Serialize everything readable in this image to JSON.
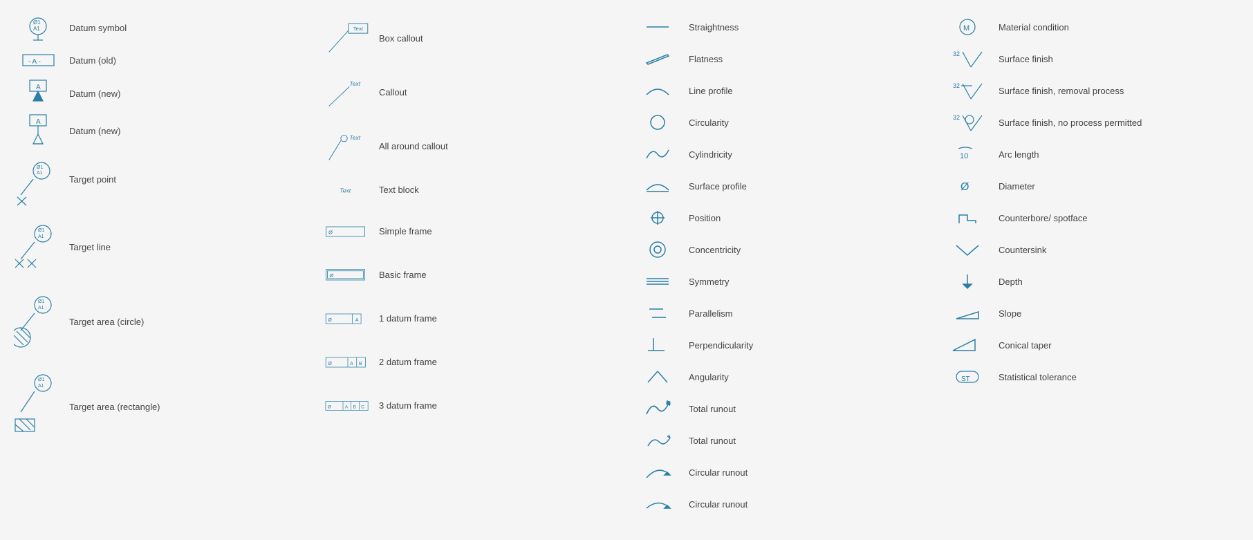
{
  "col1": {
    "items": [
      {
        "id": "datum-symbol",
        "label": "Datum symbol"
      },
      {
        "id": "datum-old",
        "label": "Datum (old)"
      },
      {
        "id": "datum-new-1",
        "label": "Datum (new)"
      },
      {
        "id": "datum-new-2",
        "label": "Datum (new)"
      },
      {
        "id": "target-point",
        "label": "Target point"
      },
      {
        "id": "target-line",
        "label": "Target line"
      },
      {
        "id": "target-area-circle",
        "label": "Target area (circle)"
      },
      {
        "id": "target-area-rect",
        "label": "Target area (rectangle)"
      }
    ]
  },
  "col2": {
    "items": [
      {
        "id": "box-callout",
        "label": "Box callout"
      },
      {
        "id": "callout",
        "label": "Callout"
      },
      {
        "id": "all-around-callout",
        "label": "All around callout"
      },
      {
        "id": "text-block",
        "label": "Text block"
      },
      {
        "id": "simple-frame",
        "label": "Simple frame"
      },
      {
        "id": "basic-frame",
        "label": "Basic frame"
      },
      {
        "id": "1-datum-frame",
        "label": "1 datum frame"
      },
      {
        "id": "2-datum-frame",
        "label": "2 datum frame"
      },
      {
        "id": "3-datum-frame",
        "label": "3 datum frame"
      }
    ]
  },
  "col3": {
    "items": [
      {
        "id": "straightness",
        "label": "Straightness"
      },
      {
        "id": "flatness",
        "label": "Flatness"
      },
      {
        "id": "line-profile",
        "label": "Line profile"
      },
      {
        "id": "circularity",
        "label": "Circularity"
      },
      {
        "id": "cylindricity",
        "label": "Cylindricity"
      },
      {
        "id": "surface-profile",
        "label": "Surface profile"
      },
      {
        "id": "position",
        "label": "Position"
      },
      {
        "id": "concentricity",
        "label": "Concentricity"
      },
      {
        "id": "symmetry",
        "label": "Symmetry"
      },
      {
        "id": "parallelism",
        "label": "Parallelism"
      },
      {
        "id": "perpendicularity",
        "label": "Perpendicularity"
      },
      {
        "id": "angularity",
        "label": "Angularity"
      },
      {
        "id": "total-runout-1",
        "label": "Total runout"
      },
      {
        "id": "total-runout-2",
        "label": "Total runout"
      },
      {
        "id": "circular-runout-1",
        "label": "Circular runout"
      },
      {
        "id": "circular-runout-2",
        "label": "Circular runout"
      }
    ]
  },
  "col4": {
    "items": [
      {
        "id": "material-condition",
        "label": "Material condition"
      },
      {
        "id": "surface-finish",
        "label": "Surface finish"
      },
      {
        "id": "surface-finish-removal",
        "label": "Surface finish, removal process"
      },
      {
        "id": "surface-finish-no-process",
        "label": "Surface finish, no process permitted"
      },
      {
        "id": "arc-length",
        "label": "Arc length"
      },
      {
        "id": "diameter",
        "label": "Diameter"
      },
      {
        "id": "counterbore",
        "label": "Counterbore/ spotface"
      },
      {
        "id": "countersink",
        "label": "Countersink"
      },
      {
        "id": "depth",
        "label": "Depth"
      },
      {
        "id": "slope",
        "label": "Slope"
      },
      {
        "id": "conical-taper",
        "label": "Conical taper"
      },
      {
        "id": "statistical-tolerance",
        "label": "Statistical tolerance"
      }
    ]
  }
}
